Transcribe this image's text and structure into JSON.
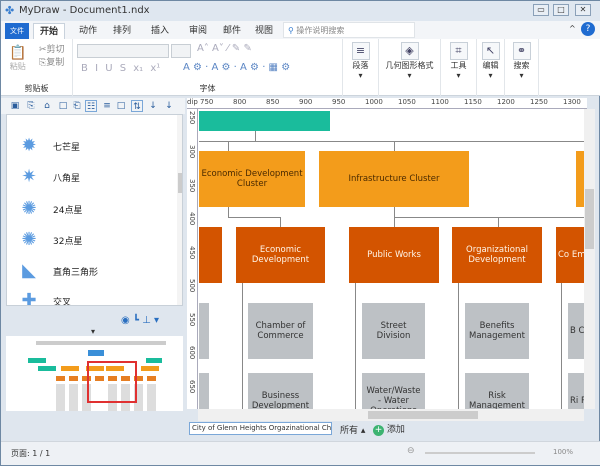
{
  "window": {
    "title": "MyDraw - Document1.ndx",
    "min": "▭",
    "max": "□",
    "close": "✕"
  },
  "tabs": [
    {
      "label": "文件"
    },
    {
      "label": "开始"
    },
    {
      "label": "动作"
    },
    {
      "label": "排列"
    },
    {
      "label": "插入"
    },
    {
      "label": "审阅"
    },
    {
      "label": "邮件"
    },
    {
      "label": "视图"
    }
  ],
  "search_placeholder": "操作说明搜索",
  "ribbon": {
    "clipboard": {
      "paste": "粘贴",
      "cut": "剪切",
      "copy": "复制",
      "label": "剪贴板"
    },
    "font": {
      "label": "字体",
      "bold": "B",
      "italic": "I",
      "underline": "U",
      "strike": "S",
      "sub": "x₁",
      "sup": "x¹"
    },
    "paragraph": "段落",
    "geometry": "几何图形格式",
    "tools": "工具",
    "edit": "编辑",
    "find": "搜索"
  },
  "shapes": [
    {
      "label": "七芒星",
      "icon": "✹"
    },
    {
      "label": "八角星",
      "icon": "✷"
    },
    {
      "label": "24点星",
      "icon": "✺"
    },
    {
      "label": "32点星",
      "icon": "✺"
    },
    {
      "label": "直角三角形",
      "icon": "◣"
    },
    {
      "label": "交叉",
      "icon": "✚"
    }
  ],
  "ruler": {
    "unit": "dip",
    "top": [
      "750",
      "800",
      "850",
      "900",
      "950",
      "1000",
      "1050",
      "1100",
      "1150",
      "1200",
      "1250",
      "1300"
    ],
    "left": [
      "250",
      "300",
      "350",
      "400",
      "450",
      "500",
      "550",
      "600",
      "650"
    ]
  },
  "chart": {
    "cluster": [
      {
        "label": "Economic Development Cluster"
      },
      {
        "label": "Infrastructure Cluster"
      }
    ],
    "dept": [
      {
        "label": "Economic Development"
      },
      {
        "label": "Public Works"
      },
      {
        "label": "Organizational Development"
      },
      {
        "label": "Co Em"
      }
    ],
    "units1": [
      {
        "label": "Chamber of Commerce"
      },
      {
        "label": "Street Division"
      },
      {
        "label": "Benefits Management"
      },
      {
        "label": "B C"
      }
    ],
    "units2": [
      {
        "label": "Business Development"
      },
      {
        "label": "Water/Waste - Water Operations"
      },
      {
        "label": "Risk Management"
      },
      {
        "label": "Ri Re"
      }
    ]
  },
  "sheet": {
    "name": "City of Glenn Heights Orgazinational Chart",
    "all": "所有",
    "add": "添加"
  },
  "status": {
    "page": "页面: 1 / 1",
    "zoom": "100%"
  },
  "colors": {
    "teal": "#1abc9c",
    "orange": "#f39c1b",
    "dark_orange": "#d35400",
    "gray": "#bdc1c5"
  }
}
